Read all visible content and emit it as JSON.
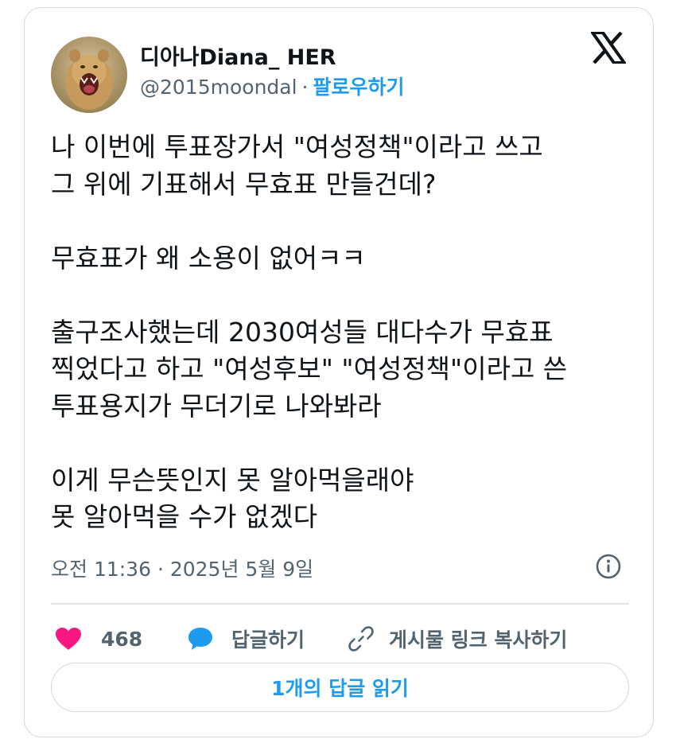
{
  "author": {
    "display_name": "디아나Diana_ HER",
    "handle": "@2015moondal",
    "separator": "·",
    "follow_label": "팔로우하기"
  },
  "tweet": {
    "lines": [
      "나 이번에 투표장가서 \"여성정책\"이라고 쓰고",
      "그 위에 기표해서 무효표 만들건데?",
      "",
      "무효표가 왜 소용이 없어ㅋㅋ",
      "",
      "출구조사했는데 2030여성들 대다수가 무효표",
      "찍었다고 하고 \"여성후보\" \"여성정책\"이라고 쓴",
      "투표용지가 무더기로 나와봐라",
      "",
      "이게 무슨뜻인지 못 알아먹을래야",
      "못 알아먹을 수가 없겠다"
    ],
    "timestamp": "오전 11:36 · 2025년 5월 9일"
  },
  "actions": {
    "like_count": "468",
    "reply_label": "답글하기",
    "copy_link_label": "게시물 링크 복사하기"
  },
  "read_replies_label": "1개의 답글 읽기",
  "icons": {
    "logo": "x-logo-icon",
    "info": "info-icon",
    "like": "heart-icon",
    "reply": "speech-bubble-icon",
    "link": "link-icon"
  },
  "colors": {
    "accent": "#1d9bf0",
    "like": "#f91880",
    "text_primary": "#0f1419",
    "text_secondary": "#536471",
    "border": "#cfd9de"
  }
}
